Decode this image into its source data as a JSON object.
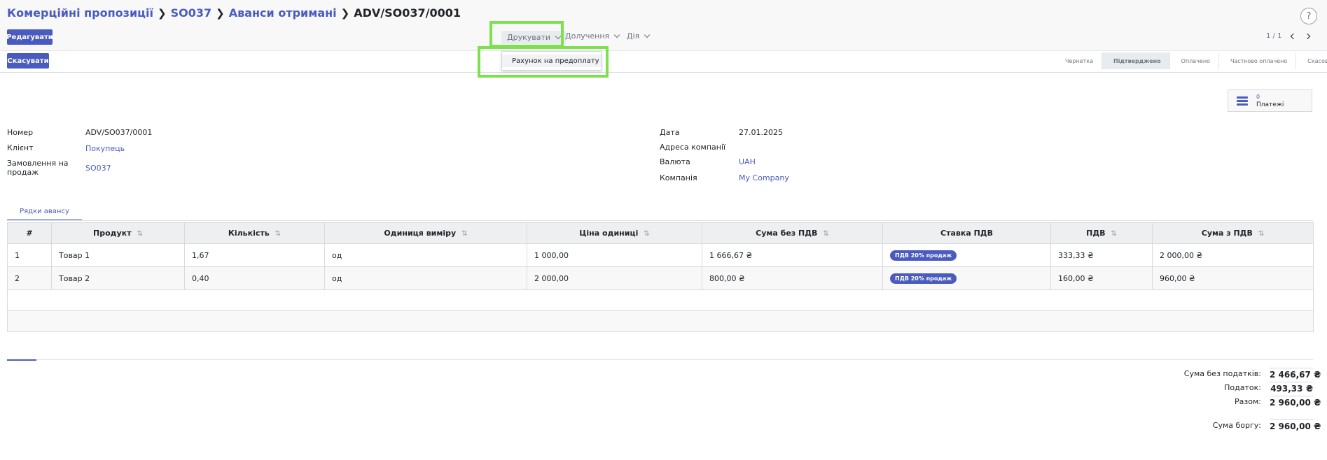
{
  "breadcrumb": {
    "items": [
      "Комерційні пропозиції",
      "SO037",
      "Аванси отримані"
    ],
    "current": "ADV/SO037/0001"
  },
  "help_label": "?",
  "toolbar": {
    "edit_label": "Редагувати",
    "cancel_label": "Скасувати",
    "print_label": "Друкувати",
    "receive_label": "Долучення",
    "action_label": "Дія"
  },
  "print_menu": {
    "items": [
      "Рахунок на предоплату"
    ]
  },
  "pager": {
    "value": "1 / 1"
  },
  "statusbar": {
    "steps": [
      "Чернетка",
      "Підтверджено",
      "Оплачено",
      "Частково оплачено",
      "Скасовано"
    ],
    "active": "Підтверджено"
  },
  "smart_button": {
    "count": "0",
    "label": "Платежі"
  },
  "form": {
    "number_label": "Номер",
    "number_value": "ADV/SO037/0001",
    "client_label": "Клієнт",
    "client_value": "Покупець",
    "order_label": "Замовлення на продаж",
    "order_value": "SO037",
    "date_label": "Дата",
    "date_value": "27.01.2025",
    "address_label": "Адреса компанії",
    "currency_label": "Валюта",
    "currency_value": "UAH",
    "company_label": "Компанія",
    "company_value": "My Company"
  },
  "tab_label": "Рядки авансу",
  "table": {
    "headers": [
      "#",
      "Продукт",
      "Кількість",
      "Одиниця виміру",
      "Ціна одиниці",
      "Сума без ПДВ",
      "Ставка ПДВ",
      "ПДВ",
      "Сума з ПДВ"
    ],
    "sort_icon": "⇅",
    "rows": [
      [
        "1",
        "Товар 1",
        "1,67",
        "од",
        "1 000,00",
        "1 666,67 ₴",
        "ПДВ 20% продаж",
        "333,33 ₴",
        "2 000,00 ₴"
      ],
      [
        "2",
        "Товар 2",
        "0,40",
        "од",
        "2 000,00",
        "800,00 ₴",
        "ПДВ 20% продаж",
        "160,00 ₴",
        "960,00 ₴"
      ]
    ]
  },
  "totals": {
    "untaxed_label": "Сума без податків:",
    "untaxed_value": "2 466,67 ₴",
    "tax_label": "Податок:",
    "tax_value": "493,33 ₴",
    "total_label": "Разом:",
    "total_value": "2 960,00 ₴",
    "due_label": "Сума боргу:",
    "due_value": "2 960,00 ₴"
  },
  "colors": {
    "accent": "#4a5bbf",
    "highlight": "#7de14f"
  }
}
